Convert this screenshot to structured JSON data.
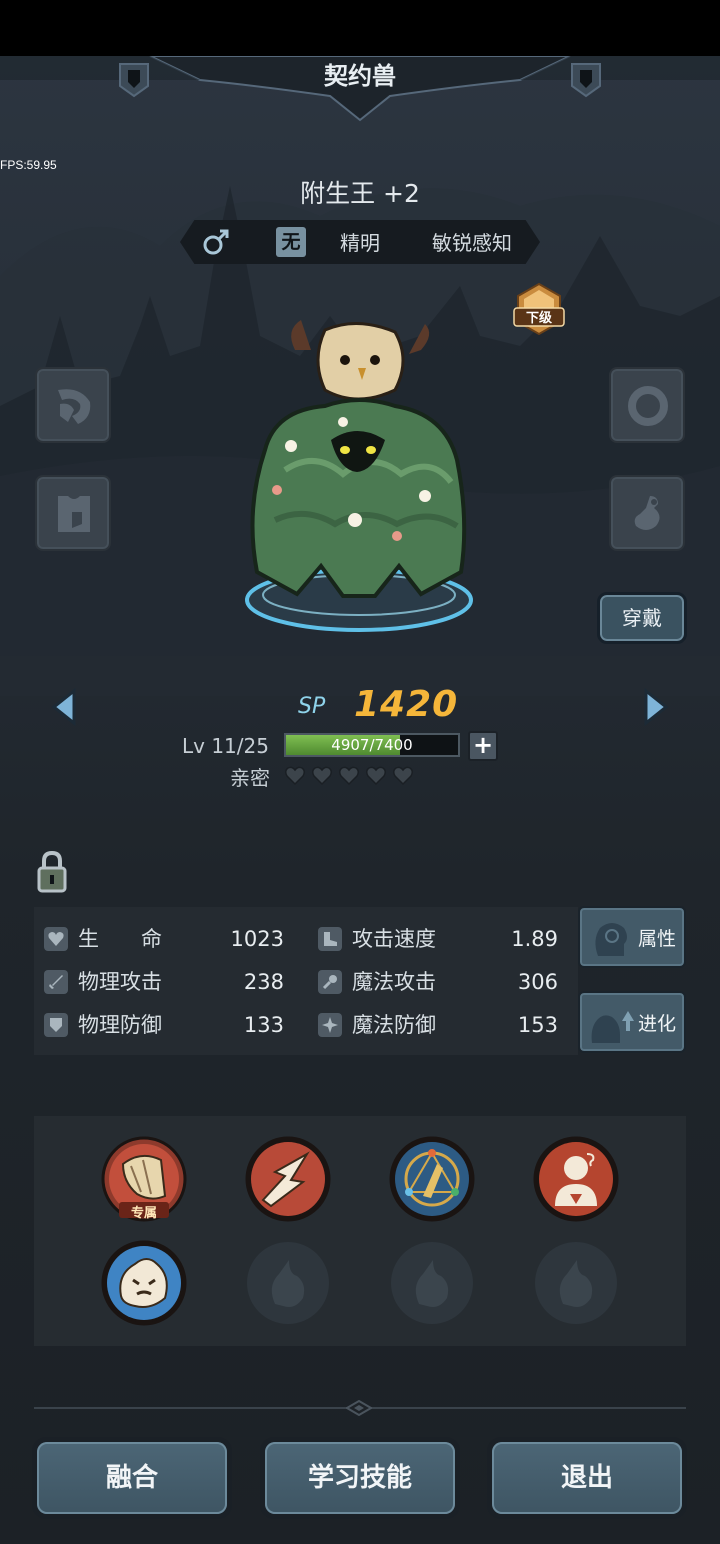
{
  "header": {
    "title": "契约兽"
  },
  "fps": "FPS:59.95",
  "pet": {
    "name": "附生王 +2",
    "gender_symbol": "♂",
    "attribute": "无",
    "traits": [
      "精明",
      "敏锐感知"
    ],
    "grade": "下级"
  },
  "actions": {
    "wear": "穿戴"
  },
  "sp": {
    "label": "SP",
    "value": "1420"
  },
  "level": {
    "label": "Lv 11/25",
    "exp_text": "4907/7400",
    "exp_fraction": 0.663,
    "plus": "+"
  },
  "intimacy": {
    "label": "亲密",
    "hearts_total": 5,
    "hearts_filled": 0
  },
  "stats": [
    {
      "label": "生　　命",
      "value": "1023",
      "icon": "heart-shield-icon"
    },
    {
      "label": "攻击速度",
      "value": "1.89",
      "icon": "boot-icon"
    },
    {
      "label": "物理攻击",
      "value": "238",
      "icon": "sword-icon"
    },
    {
      "label": "魔法攻击",
      "value": "306",
      "icon": "wand-icon"
    },
    {
      "label": "物理防御",
      "value": "133",
      "icon": "shield-icon"
    },
    {
      "label": "魔法防御",
      "value": "153",
      "icon": "magic-shield-icon"
    }
  ],
  "side_buttons": {
    "attributes": "属性",
    "evolve": "进化"
  },
  "skills": {
    "exclusive_tag": "专属",
    "items": [
      "wing-claw-skill",
      "slash-skill",
      "rune-circle-skill",
      "debuff-skill",
      "angry-spirit-skill",
      "locked-slot",
      "locked-slot",
      "locked-slot"
    ]
  },
  "bottom_buttons": {
    "fuse": "融合",
    "learn_skill": "学习技能",
    "exit": "退出"
  },
  "colors": {
    "sp_value": "#f5b63a",
    "sp_label": "#8fd3ea",
    "exp_fill": "#6aa844",
    "button": "#435a68"
  }
}
